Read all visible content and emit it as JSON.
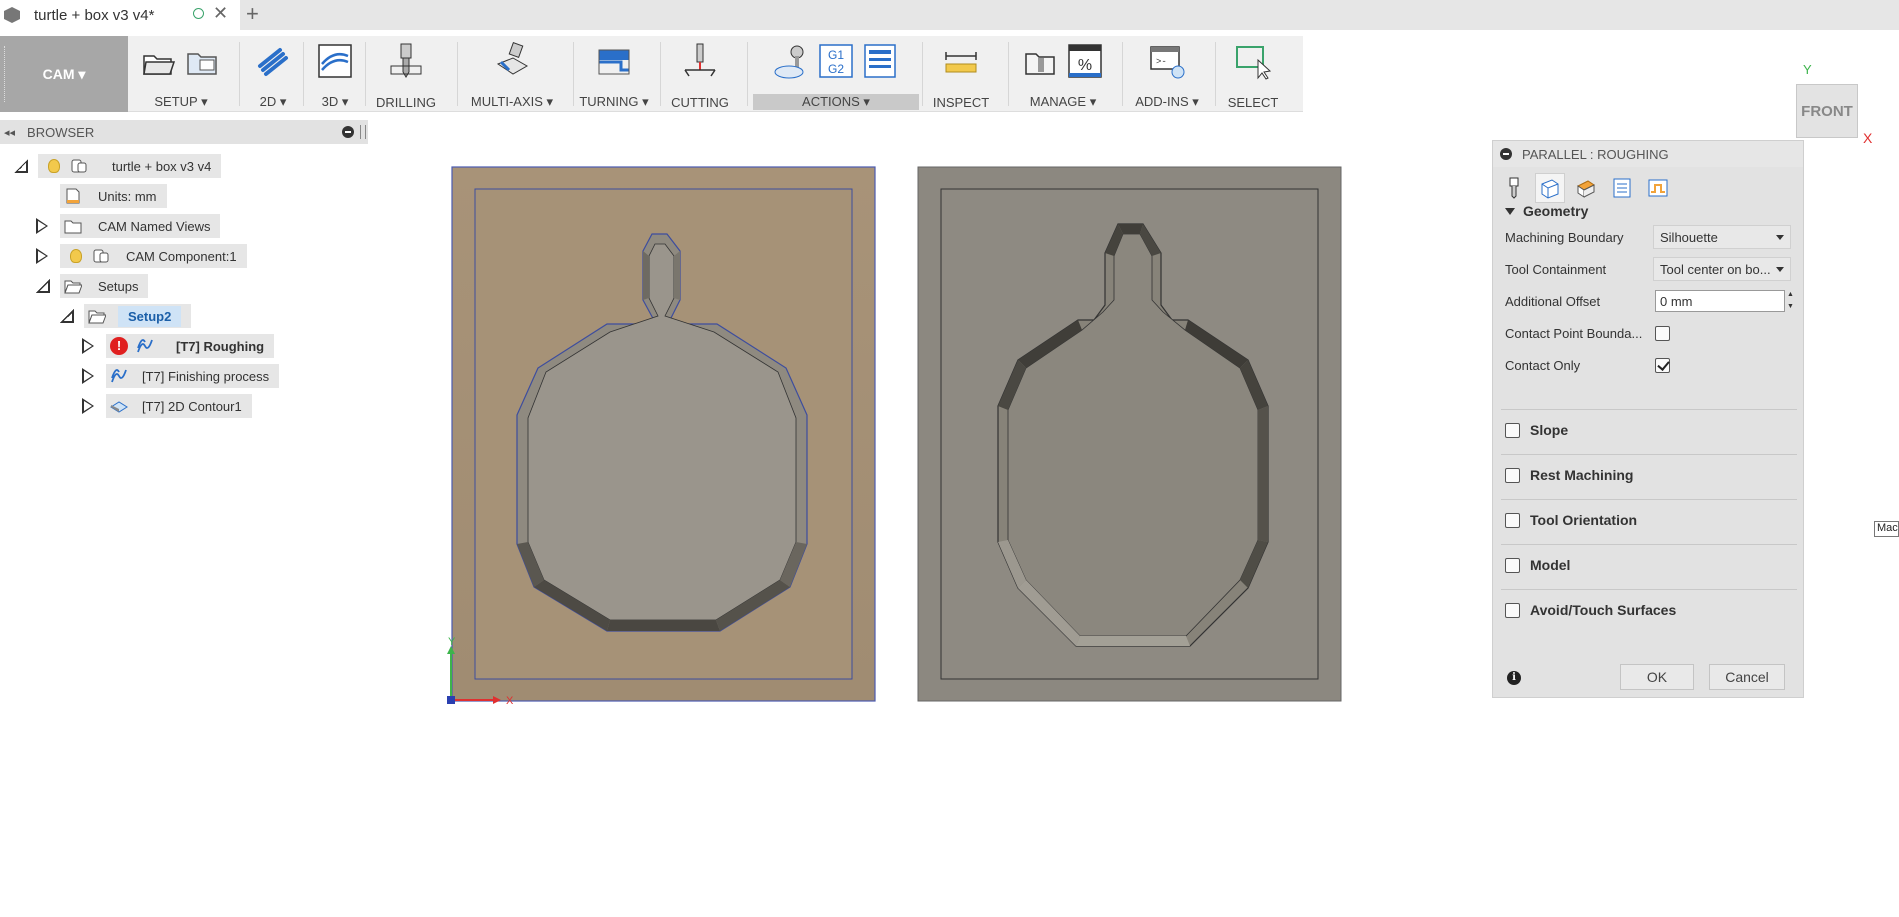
{
  "window": {
    "tab_title": "turtle + box v3 v4*",
    "new_tab": "+"
  },
  "toolbar": {
    "workspace": "CAM",
    "groups": [
      {
        "label": "SETUP ▾"
      },
      {
        "label": "2D ▾"
      },
      {
        "label": "3D ▾"
      },
      {
        "label": "DRILLING"
      },
      {
        "label": "MULTI-AXIS ▾"
      },
      {
        "label": "TURNING ▾"
      },
      {
        "label": "CUTTING"
      },
      {
        "label": "ACTIONS ▾"
      },
      {
        "label": "INSPECT"
      },
      {
        "label": "MANAGE ▾"
      },
      {
        "label": "ADD-INS ▾"
      },
      {
        "label": "SELECT"
      }
    ],
    "actions_g1g2": "G1\nG2",
    "manage_percent": "%"
  },
  "browser": {
    "title": "BROWSER",
    "tree": [
      {
        "label": "turtle + box v3 v4",
        "icon": "component-icon"
      },
      {
        "label": "Units: mm",
        "icon": "document-icon"
      },
      {
        "label": "CAM Named Views",
        "icon": "folder-icon"
      },
      {
        "label": "CAM Component:1",
        "icon": "component-icon"
      },
      {
        "label": "Setups",
        "icon": "folder-open-icon"
      },
      {
        "label": "Setup2",
        "icon": "folder-open-icon"
      },
      {
        "label": "[T7] Roughing",
        "icon": "roughing-icon"
      },
      {
        "label": "[T7] Finishing process",
        "icon": "finishing-icon"
      },
      {
        "label": "[T7] 2D Contour1",
        "icon": "contour-icon"
      }
    ]
  },
  "viewport": {
    "axis_x": "X",
    "axis_y": "Y",
    "viewcube_face": "FRONT",
    "viewcube_y": "Y",
    "viewcube_x": "X",
    "edge_tooltip": "Mac"
  },
  "dialog": {
    "title": "PARALLEL : ROUGHING",
    "geometry_header": "Geometry",
    "machining_boundary": {
      "label": "Machining Boundary",
      "value": "Silhouette"
    },
    "tool_containment": {
      "label": "Tool Containment",
      "value": "Tool center on bo..."
    },
    "additional_offset": {
      "label": "Additional Offset",
      "value": "0 mm"
    },
    "contact_point_boundary": {
      "label": "Contact Point Bounda...",
      "checked": false
    },
    "contact_only": {
      "label": "Contact Only",
      "checked": true
    },
    "sections": [
      "Slope",
      "Rest Machining",
      "Tool Orientation",
      "Model",
      "Avoid/Touch Surfaces"
    ],
    "ok": "OK",
    "cancel": "Cancel",
    "info": "i"
  },
  "colors": {
    "stock_highlight": "#a89378",
    "part_grey": "#8c8880",
    "selection_blue": "#cfe3f6",
    "error_red": "#e02020"
  }
}
